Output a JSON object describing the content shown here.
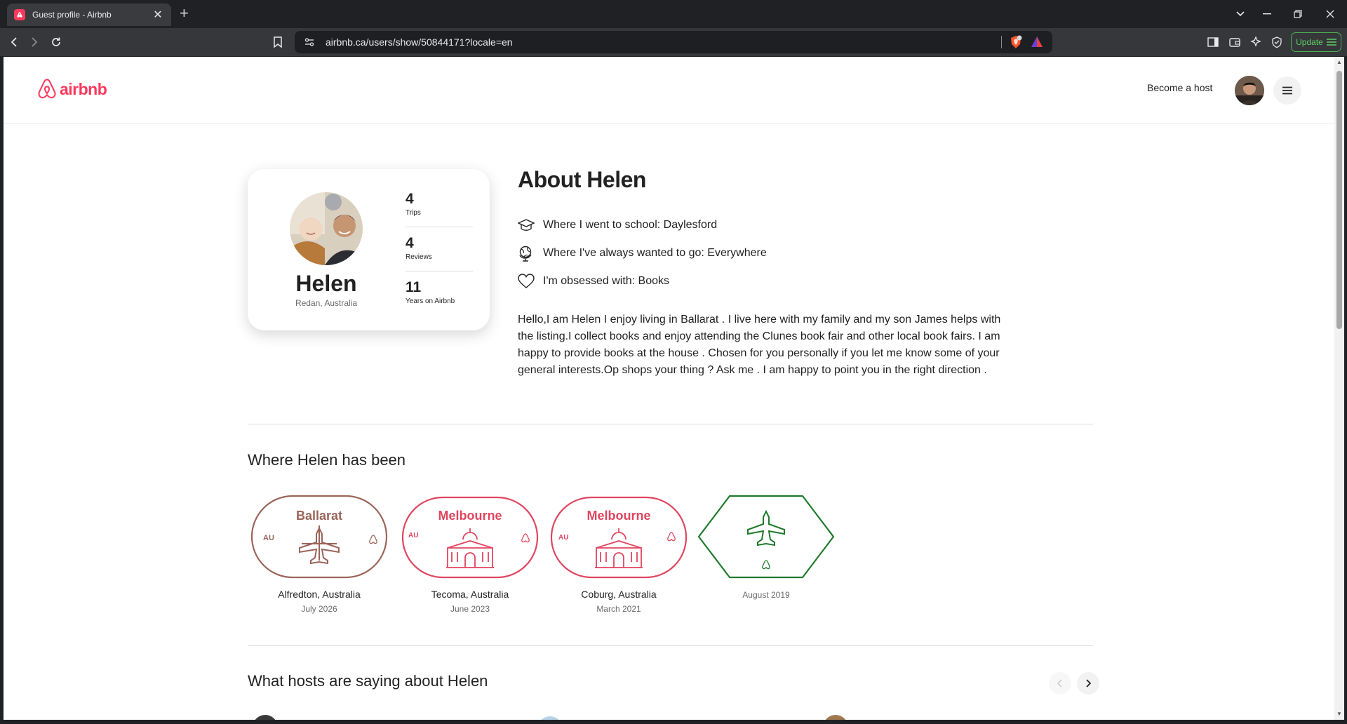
{
  "browser": {
    "tab_title": "Guest profile - Airbnb",
    "url": "airbnb.ca/users/show/50844171?locale=en",
    "update_label": "Update"
  },
  "header": {
    "logo_text": "airbnb",
    "become_host": "Become a host"
  },
  "profile": {
    "name": "Helen",
    "location": "Redan, Australia",
    "stats": [
      {
        "value": "4",
        "label": "Trips"
      },
      {
        "value": "4",
        "label": "Reviews"
      },
      {
        "value": "11",
        "label": "Years on Airbnb"
      }
    ]
  },
  "about": {
    "title": "About Helen",
    "facts": [
      {
        "icon": "graduation-cap-icon",
        "text": "Where I went to school: Daylesford"
      },
      {
        "icon": "globe-icon",
        "text": "Where I've always wanted to go: Everywhere"
      },
      {
        "icon": "heart-icon",
        "text": "I'm obsessed with: Books"
      }
    ],
    "bio": "Hello,I  am Helen  I enjoy living in Ballarat . I live here with my family and my son James helps with the listing.I collect books and enjoy attending the Clunes book fair and other local book fairs. I am happy to provide books at the house . Chosen for you personally if you let me know some of your general interests.Op shops your thing ? Ask me . I am happy to point you in the right direction ."
  },
  "been": {
    "title": "Where Helen has been",
    "stamps": [
      {
        "stamp_city": "Ballarat",
        "country": "AU",
        "place": "Alfredton, Australia",
        "date": "July 2026",
        "color": "#9b6459"
      },
      {
        "stamp_city": "Melbourne",
        "country": "AU",
        "place": "Tecoma, Australia",
        "date": "June 2023",
        "color": "#e0455f"
      },
      {
        "stamp_city": "Melbourne",
        "country": "AU",
        "place": "Coburg, Australia",
        "date": "March 2021",
        "color": "#e0455f"
      },
      {
        "stamp_city": "",
        "country": "",
        "place": "",
        "date": "August 2019",
        "color": "#1f7a2c"
      }
    ]
  },
  "reviews": {
    "title": "What hosts are saying about Helen"
  },
  "colors": {
    "brand": "#ff385c",
    "text": "#222222",
    "muted": "#6a6a6a"
  }
}
